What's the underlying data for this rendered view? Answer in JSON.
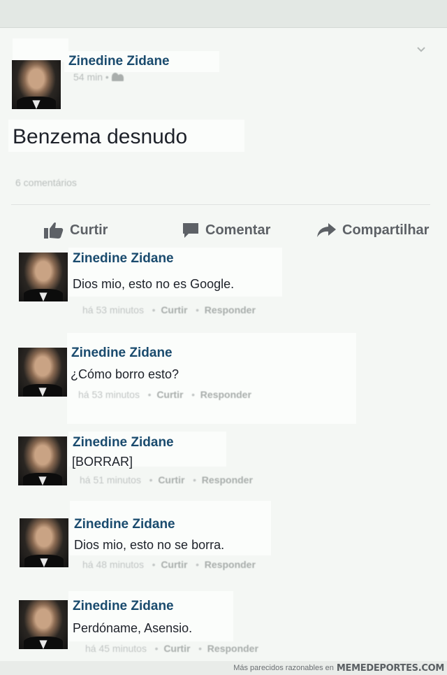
{
  "post": {
    "author": "Zinedine Zidane",
    "time": "54 min",
    "audience_icon": "group-icon",
    "text": "Benzema desnudo",
    "comment_count": "6 comentários"
  },
  "actions": [
    {
      "label": "Curtir",
      "icon": "thumbs-up-icon"
    },
    {
      "label": "Comentar",
      "icon": "comment-icon"
    },
    {
      "label": "Compartilhar",
      "icon": "share-arrow-icon"
    }
  ],
  "comments": [
    {
      "author": "Zinedine Zidane",
      "text": "Dios mio, esto no es Google.",
      "time": "há 53 minutos",
      "like": "Curtir",
      "reply": "Responder"
    },
    {
      "author": "Zinedine Zidane",
      "text": "¿Cómo borro esto?",
      "time": "há 53 minutos",
      "like": "Curtir",
      "reply": "Responder"
    },
    {
      "author": "Zinedine Zidane",
      "text": "[BORRAR]",
      "time": "há 51 minutos",
      "like": "Curtir",
      "reply": "Responder"
    },
    {
      "author": "Zinedine Zidane",
      "text": "Dios mio, esto no se borra.",
      "time": "há 48 minutos",
      "like": "Curtir",
      "reply": "Responder"
    },
    {
      "author": "Zinedine Zidane",
      "text": "Perdóname, Asensio.",
      "time": "há 45 minutos",
      "like": "Curtir",
      "reply": "Responder"
    }
  ],
  "footer": {
    "tagline": "Más parecidos razonables en",
    "brand": "MEMEDEPORTES.COM"
  },
  "colors": {
    "author_name": "#1a4b6e",
    "background": "#f4f7f4",
    "action_text": "#5d6166"
  }
}
